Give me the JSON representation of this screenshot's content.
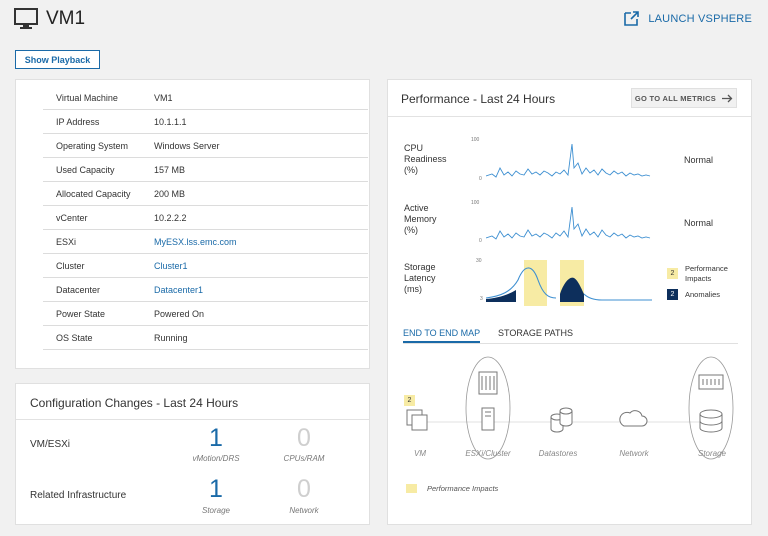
{
  "header": {
    "title": "VM1",
    "launch_label": "LAUNCH VSPHERE",
    "playback_label": "Show Playback"
  },
  "properties": [
    {
      "label": "Virtual Machine",
      "value": "VM1",
      "link": false
    },
    {
      "label": "IP Address",
      "value": "10.1.1.1",
      "link": false
    },
    {
      "label": "Operating System",
      "value": "Windows Server",
      "link": false
    },
    {
      "label": "Used Capacity",
      "value": "157 MB",
      "link": false
    },
    {
      "label": "Allocated Capacity",
      "value": "200 MB",
      "link": false
    },
    {
      "label": "vCenter",
      "value": "10.2.2.2",
      "link": false
    },
    {
      "label": "ESXi",
      "value": "MyESX.lss.emc.com",
      "link": true
    },
    {
      "label": "Cluster",
      "value": "Cluster1",
      "link": true
    },
    {
      "label": "Datacenter",
      "value": "Datacenter1",
      "link": true
    },
    {
      "label": "Power State",
      "value": "Powered On",
      "link": false
    },
    {
      "label": "OS State",
      "value": "Running",
      "link": false
    }
  ],
  "config": {
    "title": "Configuration Changes - Last 24 Hours",
    "rows": [
      {
        "label": "VM/ESXi",
        "items": [
          {
            "value": "1",
            "caption": "vMotion/DRS"
          },
          {
            "value": "0",
            "caption": "CPUs/RAM"
          }
        ]
      },
      {
        "label": "Related Infrastructure",
        "items": [
          {
            "value": "1",
            "caption": "Storage"
          },
          {
            "value": "0",
            "caption": "Network"
          }
        ]
      }
    ]
  },
  "performance": {
    "title": "Performance - Last 24 Hours",
    "goto_label": "GO TO ALL METRICS",
    "metrics": [
      {
        "label_lines": [
          "CPU",
          "Readiness",
          "(%)"
        ],
        "status": "Normal",
        "ymax": "100",
        "ymin": "0"
      },
      {
        "label_lines": [
          "Active",
          "Memory",
          "(%)"
        ],
        "status": "Normal",
        "ymax": "100",
        "ymin": "0"
      },
      {
        "label_lines": [
          "Storage",
          "Latency",
          "(ms)"
        ],
        "ymax": "30",
        "ymin": "3"
      }
    ],
    "legend": [
      {
        "count": "2",
        "label_lines": [
          "Performance",
          "Impacts"
        ],
        "color": "#f7eba4"
      },
      {
        "count": "2",
        "label_lines": [
          "Anomalies"
        ],
        "color": "#0d2f5c"
      }
    ],
    "tabs": [
      "END TO END MAP",
      "STORAGE PATHS"
    ],
    "map": {
      "vm_badge": "2",
      "nodes": [
        "VM",
        "ESXi/Cluster",
        "Datastores",
        "Network",
        "Storage"
      ],
      "impact_label": "Performance Impacts"
    }
  },
  "colors": {
    "accent": "#1a6aa8",
    "impact": "#f7eba4",
    "anomaly": "#0d2f5c",
    "series": "#3d8fd1"
  }
}
